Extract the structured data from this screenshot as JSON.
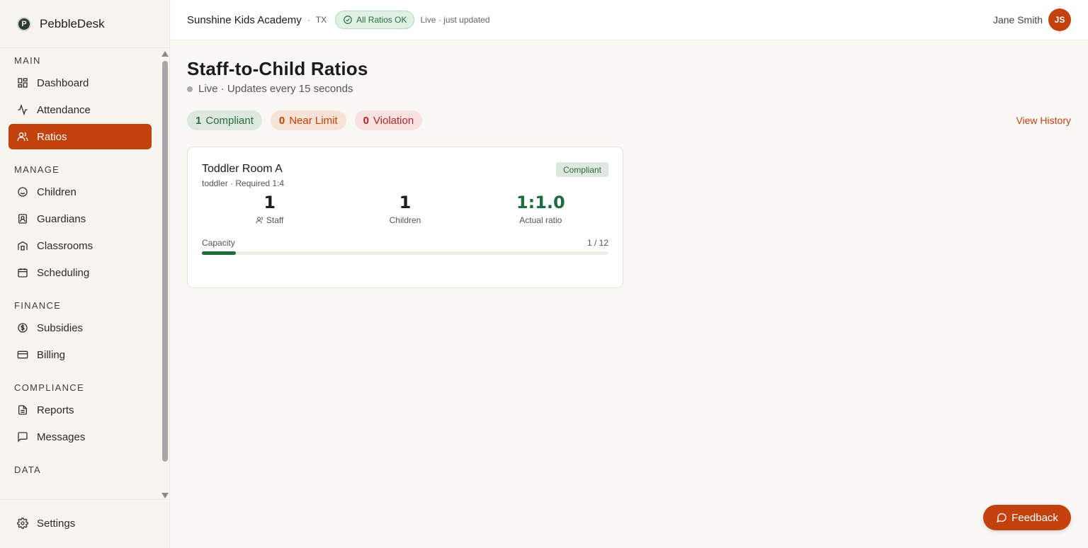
{
  "brand": {
    "name": "PebbleDesk",
    "logo_letter": "P"
  },
  "sidebar": {
    "sections": [
      {
        "title": "MAIN",
        "items": [
          {
            "label": "Dashboard",
            "icon": "dashboard-icon"
          },
          {
            "label": "Attendance",
            "icon": "activity-icon"
          },
          {
            "label": "Ratios",
            "icon": "users-icon",
            "active": true
          }
        ]
      },
      {
        "title": "MANAGE",
        "items": [
          {
            "label": "Children",
            "icon": "smile-icon"
          },
          {
            "label": "Guardians",
            "icon": "contact-icon"
          },
          {
            "label": "Classrooms",
            "icon": "building-icon"
          },
          {
            "label": "Scheduling",
            "icon": "calendar-icon"
          }
        ]
      },
      {
        "title": "FINANCE",
        "items": [
          {
            "label": "Subsidies",
            "icon": "dollar-icon"
          },
          {
            "label": "Billing",
            "icon": "credit-card-icon"
          }
        ]
      },
      {
        "title": "COMPLIANCE",
        "items": [
          {
            "label": "Reports",
            "icon": "file-icon"
          },
          {
            "label": "Messages",
            "icon": "message-icon"
          }
        ]
      },
      {
        "title": "DATA",
        "items": []
      }
    ],
    "footer": {
      "label": "Settings",
      "icon": "gear-icon"
    }
  },
  "topbar": {
    "org_name": "Sunshine Kids Academy",
    "separator": "·",
    "org_state": "TX",
    "ratio_status": "All Ratios OK",
    "live_text": "Live · just updated",
    "user_name": "Jane Smith",
    "user_initials": "JS"
  },
  "main": {
    "title": "Staff-to-Child Ratios",
    "live_status": "Live · Updates every 15 seconds",
    "summary": {
      "compliant_count": "1",
      "compliant_label": "Compliant",
      "near_count": "0",
      "near_label": "Near Limit",
      "violation_count": "0",
      "violation_label": "Violation"
    },
    "view_history": "View History",
    "rooms": [
      {
        "name": "Toddler Room A",
        "subtitle": "toddler · Required 1:4",
        "status": "Compliant",
        "staff": "1",
        "staff_label": "Staff",
        "children": "1",
        "children_label": "Children",
        "ratio": "1:1.0",
        "ratio_label": "Actual ratio",
        "capacity_label": "Capacity",
        "capacity_text": "1 / 12",
        "capacity_fraction": 0.0833
      }
    ]
  },
  "feedback_label": "Feedback",
  "colors": {
    "accent": "#c2410c",
    "success": "#1e6b3d",
    "danger": "#b4232a"
  }
}
